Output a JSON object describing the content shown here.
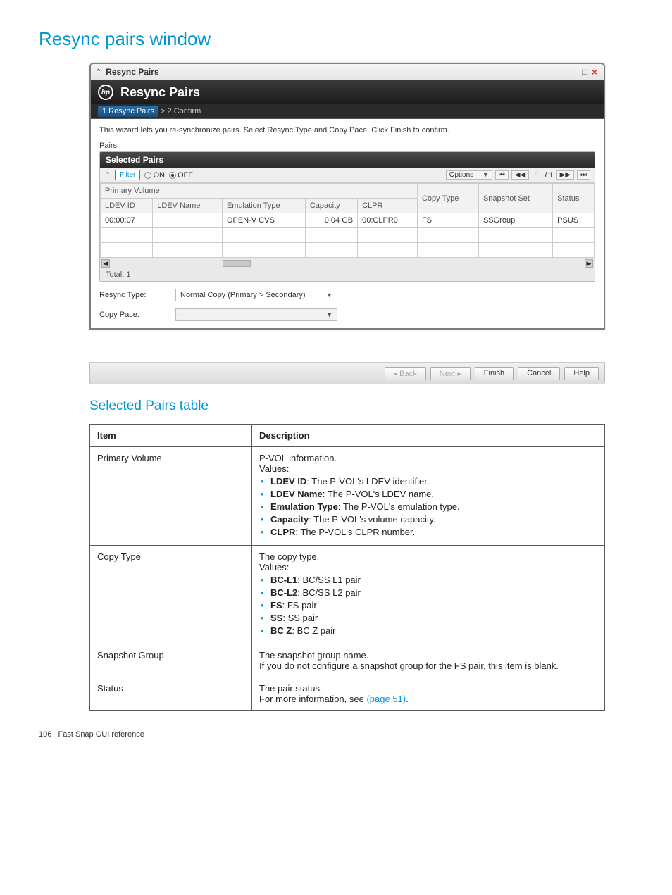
{
  "page_title": "Resync pairs window",
  "subheading": "Selected Pairs table",
  "window": {
    "titlebar": "Resync Pairs",
    "app_title": "Resync Pairs",
    "breadcrumb_step1": "1.Resync Pairs",
    "breadcrumb_sep": ">",
    "breadcrumb_step2": "2.Confirm",
    "wizard_desc": "This wizard lets you re-synchronize pairs. Select Resync Type and Copy Pace. Click Finish to confirm.",
    "pairs_label": "Pairs:",
    "panel_head": "Selected Pairs",
    "filter_btn": "Filter",
    "on_label": "ON",
    "off_label": "OFF",
    "options_btn": "Options",
    "page_indicator": "1",
    "page_total": "/ 1",
    "group_header": "Primary Volume",
    "columns": {
      "ldev_id": "LDEV ID",
      "ldev_name": "LDEV Name",
      "emulation_type": "Emulation Type",
      "capacity": "Capacity",
      "clpr": "CLPR",
      "copy_type": "Copy Type",
      "snapshot_set": "Snapshot Set",
      "status": "Status"
    },
    "row": {
      "ldev_id": "00:00:07",
      "ldev_name": "",
      "emulation_type": "OPEN-V CVS",
      "capacity": "0.04 GB",
      "clpr": "00:CLPR0",
      "copy_type": "FS",
      "snapshot_set": "SSGroup",
      "status": "PSUS"
    },
    "total_label": "Total: 1",
    "resync_type_label": "Resync Type:",
    "resync_type_value": "Normal Copy (Primary > Secondary)",
    "copy_pace_label": "Copy Pace:",
    "copy_pace_value": "-"
  },
  "footer": {
    "back": "Back",
    "next": "Next",
    "finish": "Finish",
    "cancel": "Cancel",
    "help": "Help"
  },
  "desc_table": {
    "header_item": "Item",
    "header_desc": "Description",
    "rows": [
      {
        "item": "Primary Volume",
        "lines": [
          "P-VOL information.",
          "Values:"
        ],
        "bullets": [
          {
            "b": "LDEV ID",
            "t": ": The P-VOL's LDEV identifier."
          },
          {
            "b": "LDEV Name",
            "t": ": The P-VOL's LDEV name."
          },
          {
            "b": "Emulation Type",
            "t": ": The P-VOL's emulation type."
          },
          {
            "b": "Capacity",
            "t": ": The P-VOL's volume capacity."
          },
          {
            "b": "CLPR",
            "t": ": The P-VOL's CLPR number."
          }
        ]
      },
      {
        "item": "Copy Type",
        "lines": [
          "The copy type.",
          "Values:"
        ],
        "bullets": [
          {
            "b": "BC-L1",
            "t": ": BC/SS L1 pair"
          },
          {
            "b": "BC-L2",
            "t": ": BC/SS L2 pair"
          },
          {
            "b": "FS",
            "t": ": FS pair"
          },
          {
            "b": "SS",
            "t": ": SS pair"
          },
          {
            "b": "BC Z",
            "t": ": BC Z pair"
          }
        ]
      },
      {
        "item": "Snapshot Group",
        "lines": [
          "The snapshot group name.",
          "If you do not configure a snapshot group for the FS pair, this item is blank."
        ],
        "bullets": []
      },
      {
        "item": "Status",
        "lines_html": [
          {
            "pre": "The pair status."
          },
          {
            "pre": "For more information, see ",
            "link": "(page 51)",
            "post": "."
          }
        ],
        "bullets": []
      }
    ]
  },
  "page_footer": {
    "num": "106",
    "text": "Fast Snap GUI reference"
  }
}
